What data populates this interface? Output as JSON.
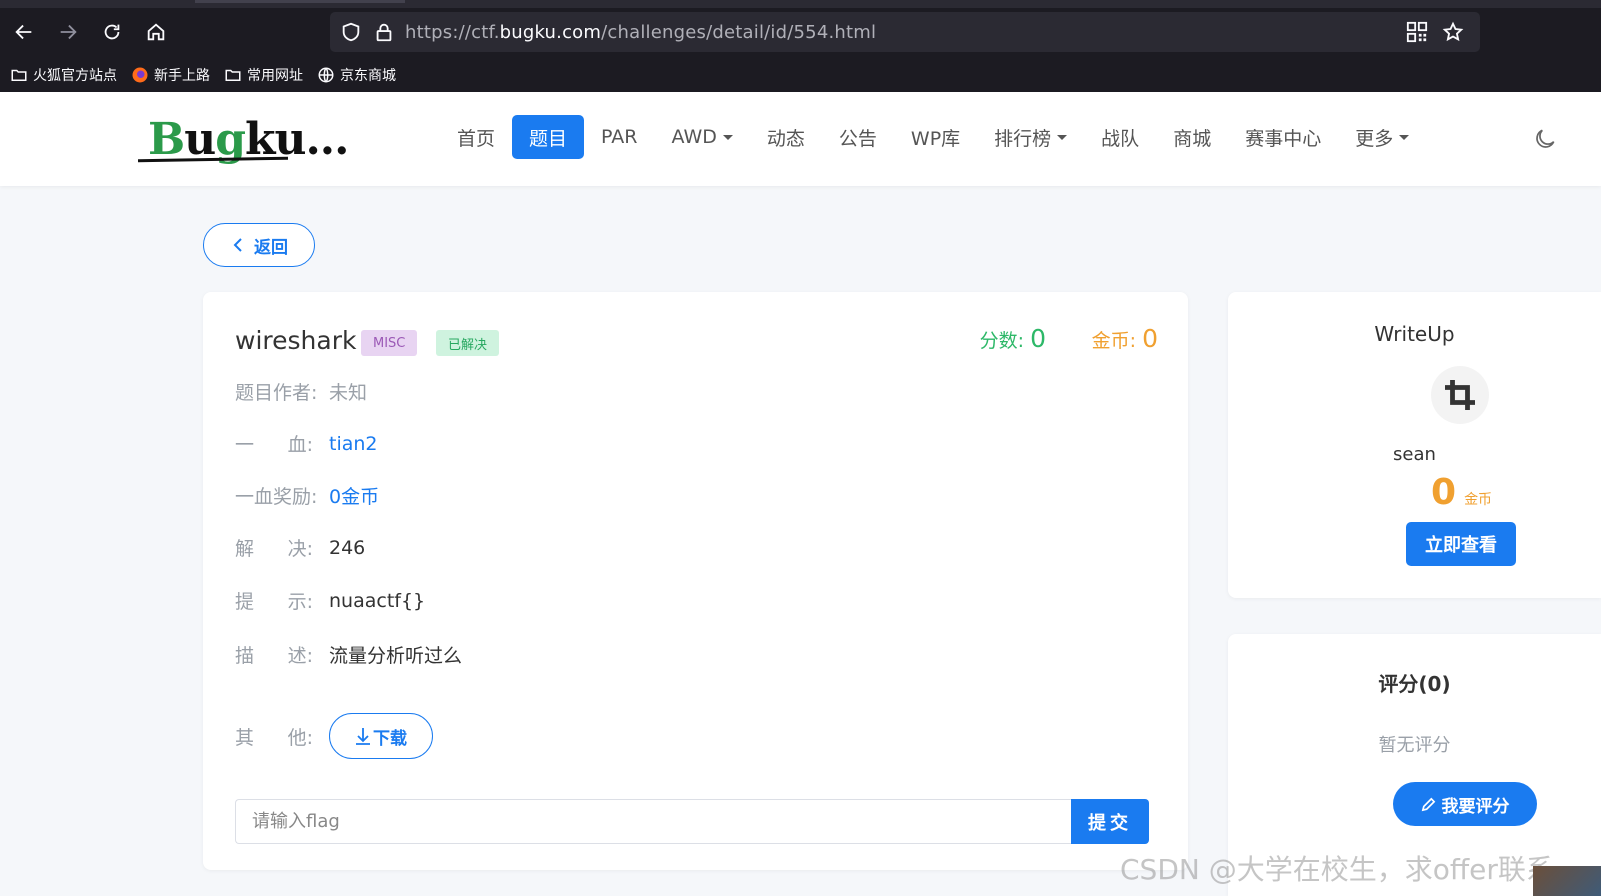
{
  "browser": {
    "url_prefix": "https://ctf.",
    "url_host": "bugku.com",
    "url_path": "/challenges/detail/id/554.html",
    "bookmarks": [
      "火狐官方站点",
      "新手上路",
      "常用网址",
      "京东商城"
    ]
  },
  "site": {
    "logo_text": [
      "B",
      "u",
      "g",
      "ku",
      "..."
    ],
    "menu": [
      "首页",
      "题目",
      "PAR",
      "AWD",
      "动态",
      "公告",
      "WP库",
      "排行榜",
      "战队",
      "商城",
      "赛事中心",
      "更多"
    ],
    "active_menu": "题目"
  },
  "back_label": "返回",
  "challenge": {
    "title": "wireshark",
    "category": "MISC",
    "status": "已解决",
    "score_label": "分数:",
    "score_value": "0",
    "coin_label": "金币:",
    "coin_value": "0",
    "author_label": "题目作者:",
    "author": "未知",
    "blood_label": [
      "一",
      "血:"
    ],
    "first_blood": "tian2",
    "reward_label": "一血奖励:",
    "reward": "0金币",
    "solves_label": [
      "解",
      "决:"
    ],
    "solves": "246",
    "hint_label": [
      "提",
      "示:"
    ],
    "hint": "nuaactf{}",
    "desc_label": [
      "描",
      "述:"
    ],
    "description": "流量分析听过么",
    "other_label": [
      "其",
      "他:"
    ],
    "download_label": "下载",
    "flag_placeholder": "请输入flag",
    "submit_label": "提交"
  },
  "writeup": {
    "title": "WriteUp",
    "author": "sean",
    "coins": "0",
    "coin_unit": "金币",
    "view_label": "立即查看"
  },
  "rating": {
    "title": "评分(0)",
    "empty": "暂无评分",
    "rate_label": "我要评分"
  },
  "watermark": "CSDN @大学在校生，求offer联系",
  "colors": {
    "primary": "#1a7bf0",
    "score": "#2db868",
    "coin": "#f0a030"
  }
}
